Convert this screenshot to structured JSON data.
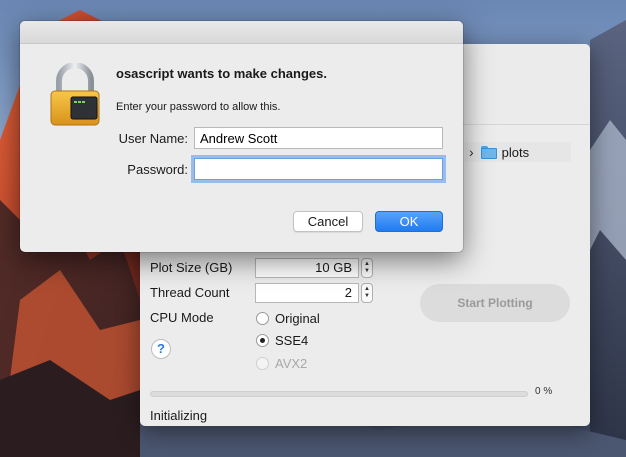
{
  "dialog": {
    "title": "osascript wants to make changes.",
    "subtitle": "Enter your password to allow this.",
    "username_label": "User Name:",
    "username_value": "Andrew Scott",
    "password_label": "Password:",
    "password_value": "",
    "cancel_label": "Cancel",
    "ok_label": "OK",
    "lock_icon": "lock-icon"
  },
  "app": {
    "path": {
      "folder_name": "plots",
      "chevron": "›"
    },
    "plot_size": {
      "label": "Plot Size (GB)",
      "value": "10 GB"
    },
    "thread_count": {
      "label": "Thread Count",
      "value": "2"
    },
    "cpu_mode": {
      "label": "CPU Mode",
      "options": [
        {
          "label": "Original",
          "selected": false,
          "disabled": false
        },
        {
          "label": "SSE4",
          "selected": true,
          "disabled": false
        },
        {
          "label": "AVX2",
          "selected": false,
          "disabled": true
        }
      ]
    },
    "help_label": "?",
    "start_label": "Start Plotting",
    "progress": {
      "percent": 0,
      "text": "0 %"
    },
    "status": "Initializing"
  },
  "colors": {
    "accent": "#1f7cf2",
    "focus_ring": "#6aa0e8"
  }
}
